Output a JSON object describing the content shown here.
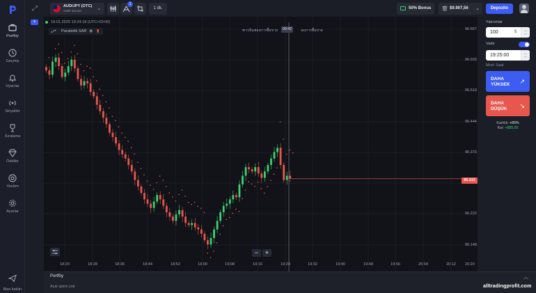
{
  "sidebar": {
    "items": [
      {
        "label": "Portföy",
        "icon": "briefcase-icon"
      },
      {
        "label": "Geçmiş",
        "icon": "history-icon"
      },
      {
        "label": "Uyarılar",
        "icon": "bell-icon"
      },
      {
        "label": "Sinyaller",
        "icon": "signal-icon"
      },
      {
        "label": "Sıralama",
        "icon": "trophy-icon"
      },
      {
        "label": "Ödüller",
        "icon": "diamond-icon"
      },
      {
        "label": "Yardım",
        "icon": "help-icon"
      },
      {
        "label": "Ayarlar",
        "icon": "gear-icon"
      }
    ],
    "contact_label": "Bize katılın"
  },
  "topbar": {
    "asset_name": "AUD/JPY (OTC)",
    "asset_sub": "Sabit Zaman",
    "timeframe": "1 dk.",
    "badge_count": "1",
    "bonus_label": "50% Bonus",
    "balance_label": "$9.907,56",
    "deposit_label": "Depozito"
  },
  "chart": {
    "timestamp": "18.01.2025 19:24:18 (UTC+03:00)",
    "indicator_name": "Parabolik SAR",
    "purchase_label": "ฑารบินช่องการซื้อขาย",
    "expiry_label": "นบการซื้อขาย",
    "timer": "00:42",
    "current_price": "96.313",
    "y_labels": [
      "96.667",
      "96.593",
      "96.519",
      "96.444",
      "96.370",
      "96.296",
      "96.222",
      "96.148"
    ],
    "x_labels": [
      "18:20",
      "18:28",
      "18:36",
      "18:44",
      "18:52",
      "19:00",
      "19:08",
      "19:16",
      "19:24",
      "19:32",
      "19:40",
      "19:48",
      "19:56",
      "20:04",
      "20:12",
      "20:20"
    ],
    "colors": {
      "up": "#3fcf74",
      "down": "#e8574e",
      "accent": "#3c5cf2"
    }
  },
  "chart_data": {
    "type": "candlestick",
    "ylim": [
      96.12,
      96.69
    ],
    "series": [
      {
        "name": "price",
        "values": [
          96.565,
          96.555,
          96.585,
          96.595,
          96.575,
          96.55,
          96.56,
          96.575,
          96.59,
          96.57,
          96.545,
          96.53,
          96.54,
          96.535,
          96.515,
          96.505,
          96.485,
          96.47,
          96.455,
          96.44,
          96.42,
          96.41,
          96.395,
          96.38,
          96.37,
          96.36,
          96.345,
          96.33,
          96.31,
          96.295,
          96.28,
          96.265,
          96.255,
          96.245,
          96.26,
          96.275,
          96.265,
          96.25,
          96.235,
          96.225,
          96.215,
          96.23,
          96.24,
          96.225,
          96.21,
          96.205,
          96.21,
          96.2,
          96.195,
          96.185,
          96.17,
          96.16,
          96.175,
          96.195,
          96.215,
          96.235,
          96.25,
          96.255,
          96.265,
          96.275,
          96.27,
          96.3,
          96.32,
          96.34,
          96.335,
          96.33,
          96.34,
          96.325,
          96.315,
          96.33,
          96.345,
          96.36,
          96.375,
          96.385,
          96.345,
          96.31,
          96.32,
          96.313
        ]
      }
    ]
  },
  "trade_panel": {
    "amount_label": "Yatırımlar",
    "amount_value": "100",
    "currency": "$",
    "time_label": "Vade",
    "time_value": "19:25:00",
    "mode_label": "Mod: Saat",
    "higher_label_1": "DAHA",
    "higher_label_2": "YÜKSEK",
    "lower_label_1": "DAHA",
    "lower_label_2": "DÜŞÜK",
    "profit_pct_label": "Karlılık:",
    "profit_pct_value": "+85%",
    "profit_amt_label": "Kar:",
    "profit_amt_value": "+$85,00"
  },
  "portfolio": {
    "title": "Portföy",
    "empty": "Açık işlem yok"
  },
  "watermark": "alltradingprofit.com"
}
